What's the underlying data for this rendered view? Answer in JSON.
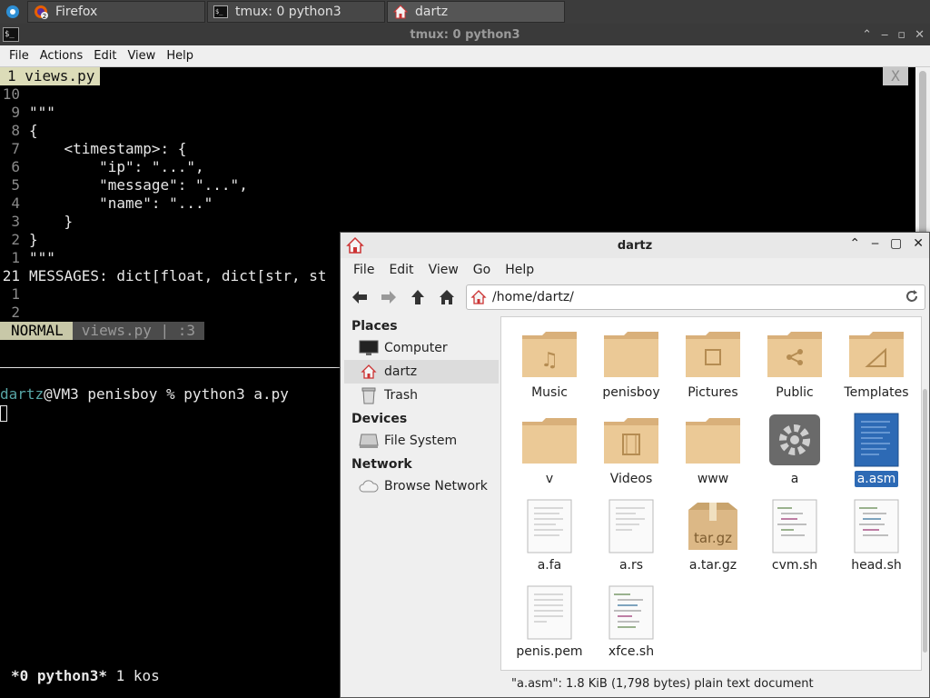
{
  "taskbar": {
    "tasks": [
      {
        "label": "Firefox",
        "badge": "2"
      },
      {
        "label": "tmux: 0 python3"
      },
      {
        "label": "dartz"
      }
    ]
  },
  "terminal": {
    "window_title": "tmux: 0 python3",
    "menu": [
      "File",
      "Actions",
      "Edit",
      "View",
      "Help"
    ],
    "vim": {
      "tab_label": "1 views.py",
      "tab_close": "X",
      "lines": [
        {
          "n": "10",
          "text": ""
        },
        {
          "n": "9",
          "text": "\"\"\""
        },
        {
          "n": "8",
          "text": "{"
        },
        {
          "n": "7",
          "text": "    <timestamp>: {"
        },
        {
          "n": "6",
          "text": "        \"ip\": \"...\","
        },
        {
          "n": "5",
          "text": "        \"message\": \"...\","
        },
        {
          "n": "4",
          "text": "        \"name\": \"...\""
        },
        {
          "n": "3",
          "text": "    }"
        },
        {
          "n": "2",
          "text": "}"
        },
        {
          "n": "1",
          "text": "\"\"\""
        },
        {
          "n": "21",
          "text": "MESSAGES: dict[float, dict[str, st"
        },
        {
          "n": "1",
          "text": ""
        },
        {
          "n": "2",
          "text": ""
        }
      ],
      "mode": "NORMAL",
      "status_file": "views.py | :3"
    },
    "shell": {
      "user": "dartz",
      "prompt_rest": "@VM3 penisboy % python3 a.py"
    },
    "tmux_status": {
      "window": "*0 python3*",
      "rest": " 1 kos"
    }
  },
  "filemanager": {
    "window_title": "dartz",
    "menu": [
      "File",
      "Edit",
      "View",
      "Go",
      "Help"
    ],
    "path": "/home/dartz/",
    "places_header": "Places",
    "places": [
      "Computer",
      "dartz",
      "Trash"
    ],
    "devices_header": "Devices",
    "devices": [
      "File System"
    ],
    "network_header": "Network",
    "network": [
      "Browse Network"
    ],
    "files": [
      {
        "name": "Music",
        "icon": "folder-music"
      },
      {
        "name": "penisboy",
        "icon": "folder"
      },
      {
        "name": "Pictures",
        "icon": "folder-pictures"
      },
      {
        "name": "Public",
        "icon": "folder-public"
      },
      {
        "name": "Templates",
        "icon": "folder-templates"
      },
      {
        "name": "v",
        "icon": "folder"
      },
      {
        "name": "Videos",
        "icon": "folder-videos"
      },
      {
        "name": "www",
        "icon": "folder"
      },
      {
        "name": "a",
        "icon": "executable"
      },
      {
        "name": "a.asm",
        "icon": "text-selected"
      },
      {
        "name": "a.fa",
        "icon": "text"
      },
      {
        "name": "a.rs",
        "icon": "text"
      },
      {
        "name": "a.tar.gz",
        "icon": "archive",
        "icon_text": "tar.gz"
      },
      {
        "name": "cvm.sh",
        "icon": "script"
      },
      {
        "name": "head.sh",
        "icon": "script"
      },
      {
        "name": "penis.pem",
        "icon": "text"
      },
      {
        "name": "xfce.sh",
        "icon": "script"
      }
    ],
    "status": "\"a.asm\": 1.8 KiB (1,798 bytes) plain text document"
  },
  "colors": {
    "selection": "#2d6ab5",
    "folder": "#e8c48e",
    "vim_tab": "#dcdcb8"
  }
}
